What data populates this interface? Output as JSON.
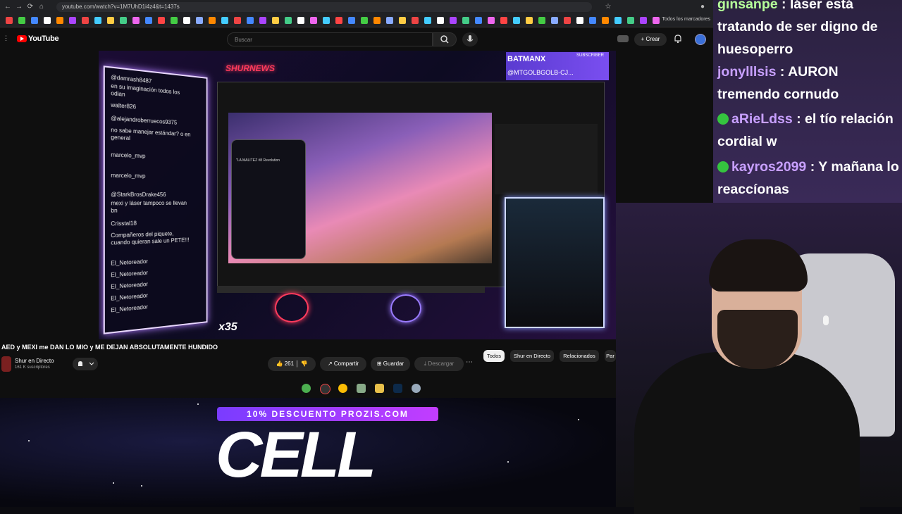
{
  "browser": {
    "url": "youtube.com/watch?v=1M7UhD1i4z4&t=1437s",
    "bookmarks_label": "Todos los marcadores"
  },
  "youtube": {
    "logo_text": "YouTube",
    "search_placeholder": "Buscar",
    "create_label": "Crear"
  },
  "player": {
    "overlay_brand": "SHURNEWS",
    "banner_name": "BATMANX",
    "banner_sub": "SUBSCRIBER",
    "banner_handle": "@MTGOLBGOLB-CJ...",
    "inner_video_title": "\"LA MALITEZ #8 Revolution",
    "x35_label": "x35",
    "chat": [
      "@damrash8487",
      "en su imaginación todos los",
      "odian",
      "walter826",
      "@alejandroberruecos9375",
      "no sabe manejar estándar? o en",
      "general",
      "marcelo_mvp",
      "marcelo_mvp",
      "@StarkBrosDrake456",
      "mexi y láser tampoco se llevan",
      "bn",
      "Crisstal18",
      "Compañeros del piquete,",
      "cuando quieran sale un PETE!!!",
      "El_Netoreador",
      "El_Netoreador",
      "El_Netoreador",
      "El_Netoreador",
      "El_Netoreador"
    ]
  },
  "video": {
    "title": "AED y MEXI me DAN LO MIO y ME DEJAN ABSOLUTAMENTE HUNDIDO",
    "channel": "Shur en Directo",
    "subscribers": "161 K suscriptores",
    "likes": "261",
    "share_label": "Compartir",
    "save_label": "Guardar",
    "download_label": "Descargar"
  },
  "chips": [
    "Todos",
    "Shur en Directo",
    "Relacionados",
    "Par"
  ],
  "promo": {
    "banner": "10% DESCUENTO PROZIS.COM",
    "headline": "CELL"
  },
  "stream_chat": [
    {
      "user": "ginsanpe",
      "text": ": láser está tratando de ser digno de huesoperro",
      "badge": false
    },
    {
      "user": "jonylllsis",
      "text": ": AURON tremendo cornudo",
      "badge": false
    },
    {
      "user": "aRieLdss",
      "text": ": el tío relación cordial w",
      "badge": true
    },
    {
      "user": "kayros2099",
      "text": ": Y mañana lo reaccíonas",
      "badge": true
    }
  ],
  "colors": {
    "yt_red": "#ff0000",
    "chat_user": "#b6ff9a",
    "chat_user_alt": "#c8a0ff",
    "promo_purple": "#7a3cff"
  }
}
